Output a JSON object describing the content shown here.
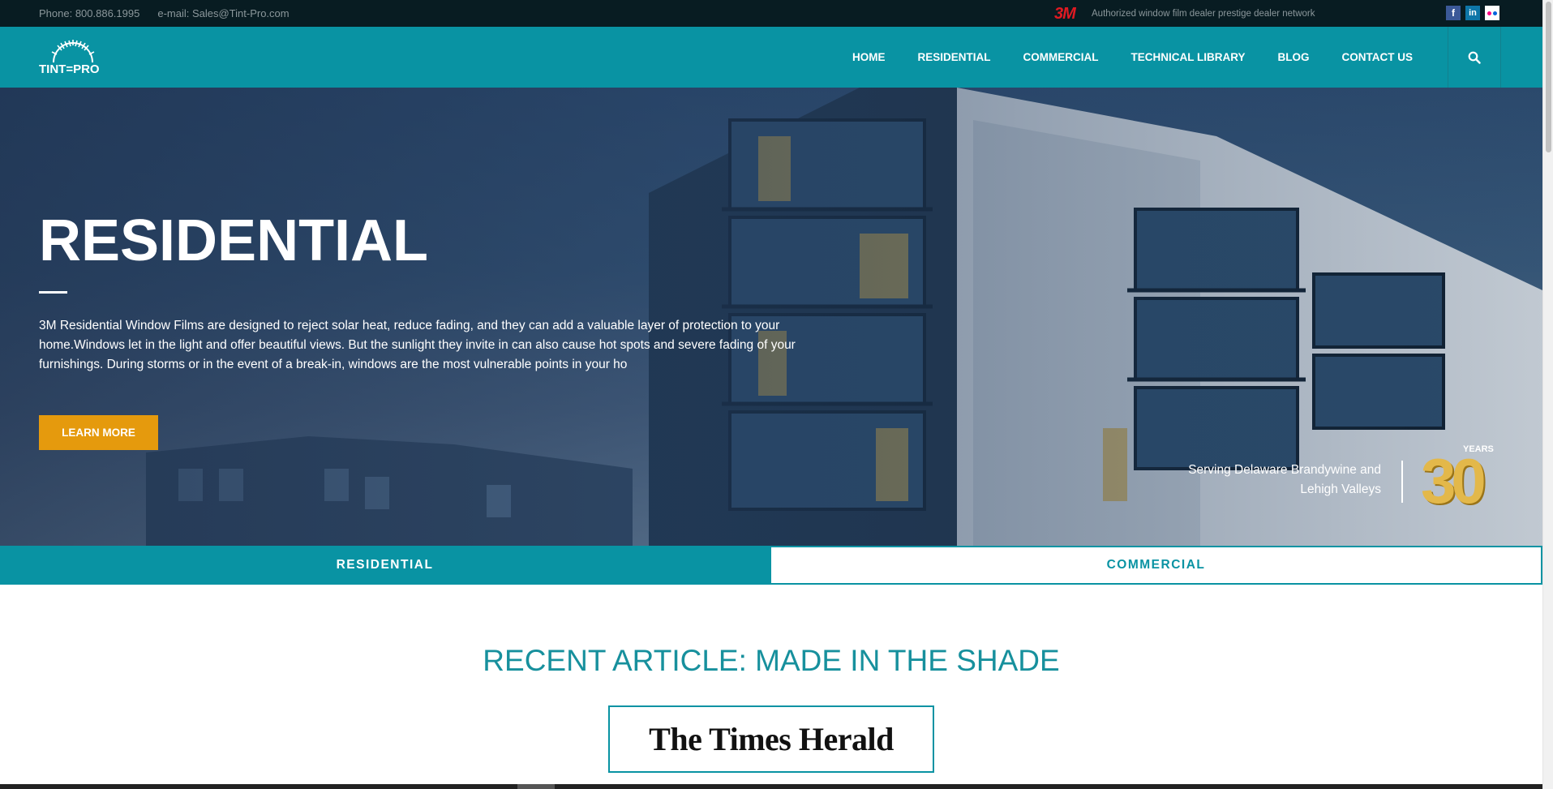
{
  "topbar": {
    "phone": "Phone: 800.886.1995",
    "email": "e-mail: Sales@Tint-Pro.com",
    "brand_3m": "3M",
    "dealer_text": "Authorized window film dealer prestige dealer network",
    "social": [
      "facebook-icon",
      "linkedin-icon",
      "flickr-icon"
    ]
  },
  "logo": {
    "wordmark": "TINT=PRO"
  },
  "nav": {
    "items": [
      "HOME",
      "RESIDENTIAL",
      "COMMERCIAL",
      "TECHNICAL LIBRARY",
      "BLOG",
      "CONTACT US"
    ],
    "search_icon": "search-icon"
  },
  "hero": {
    "title": "RESIDENTIAL",
    "description": "3M Residential Window Films are designed to reject solar heat, reduce fading, and they can add a valuable layer of protection to your home.Windows let in the light and offer beautiful views. But the sunlight they invite in can also cause hot spots and severe fading of your furnishings. During storms or in the event of a break-in, windows are the most vulnerable points in your ho",
    "cta": "LEARN MORE",
    "serving_line1": "Serving Delaware Brandywine and",
    "serving_line2": "Lehigh Valleys",
    "years_label": "YEARS",
    "years_number": "30"
  },
  "tabs": [
    {
      "label": "RESIDENTIAL",
      "active": true
    },
    {
      "label": "COMMERCIAL",
      "active": false
    }
  ],
  "article": {
    "heading": "RECENT ARTICLE: MADE IN THE SHADE",
    "publication": "The Times Herald"
  },
  "colors": {
    "accent": "#0993a3",
    "cta": "#e59a0d",
    "topbar": "#081c22",
    "gold": "#e3b84a"
  }
}
